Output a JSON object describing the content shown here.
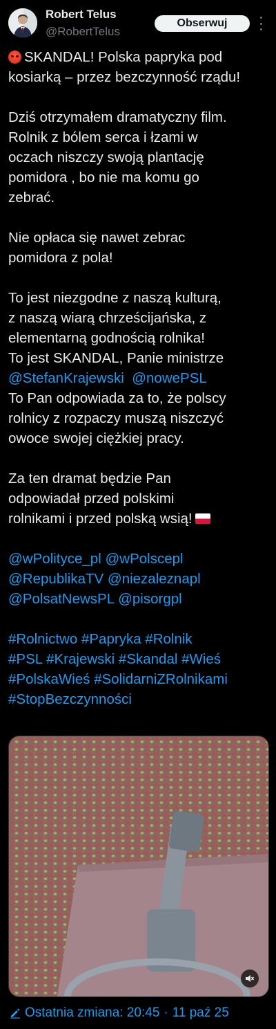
{
  "author": {
    "name": "Robert Telus",
    "handle": "@RobertTelus",
    "follow_label": "Obserwuj"
  },
  "tweet": {
    "p1": [
      "SKANDAL! Polska papryka pod",
      "kosiarką – przez bezczynność rządu!"
    ],
    "p2": [
      "Dziś otrzymałem dramatyczny film.",
      "Rolnik z bólem serca i łzami w",
      "oczach niszczy swoją plantację",
      "pomidora , bo nie ma komu go",
      "zebrać."
    ],
    "p3": [
      "Nie opłaca się nawet zebrac",
      "pomidora z pola!"
    ],
    "p4": [
      "To jest niezgodne z naszą kulturą,",
      "z naszą wiarą chrześcijańska, z",
      "elementarną godnością rolnika!",
      "To jest SKANDAL, Panie ministrze"
    ],
    "p4_mentions": [
      "@StefanKrajewski",
      "@nowePSL"
    ],
    "p4_tail": [
      "To Pan odpowiada za to, że polscy",
      "rolnicy z rozpaczy muszą niszczyć",
      "owoce swojej ciężkiej pracy."
    ],
    "p5": [
      "Za ten dramat będzie Pan",
      "odpowiadał przed polskimi",
      "rolnikami i przed polską wsią!"
    ],
    "mentions": [
      [
        "@wPolityce_pl",
        "@wPolscepl"
      ],
      [
        "@RepublikaTV",
        "@niezaleznapl"
      ],
      [
        "@PolsatNewsPL",
        "@pisorgpl"
      ]
    ],
    "hashtags": [
      [
        "#Rolnictwo",
        "#Papryka",
        "#Rolnik"
      ],
      [
        "#PSL",
        "#Krajewski",
        "#Skandal",
        "#Wieś"
      ],
      [
        "#PolskaWieś",
        "#SolidarniZRolnikami"
      ],
      [
        "#StopBezczynności"
      ]
    ]
  },
  "edited": {
    "label": "Ostatnia zmiana: 20:45",
    "separator": "·",
    "date": "11 paź 25"
  },
  "colors": {
    "background": "#000000",
    "text": "#e7e9ea",
    "secondary": "#71767b",
    "link": "#1d9bf0"
  },
  "icons": [
    "avatar",
    "more-icon",
    "angry-face-emoji",
    "polish-flag-emoji",
    "mute-icon",
    "pencil-icon"
  ]
}
